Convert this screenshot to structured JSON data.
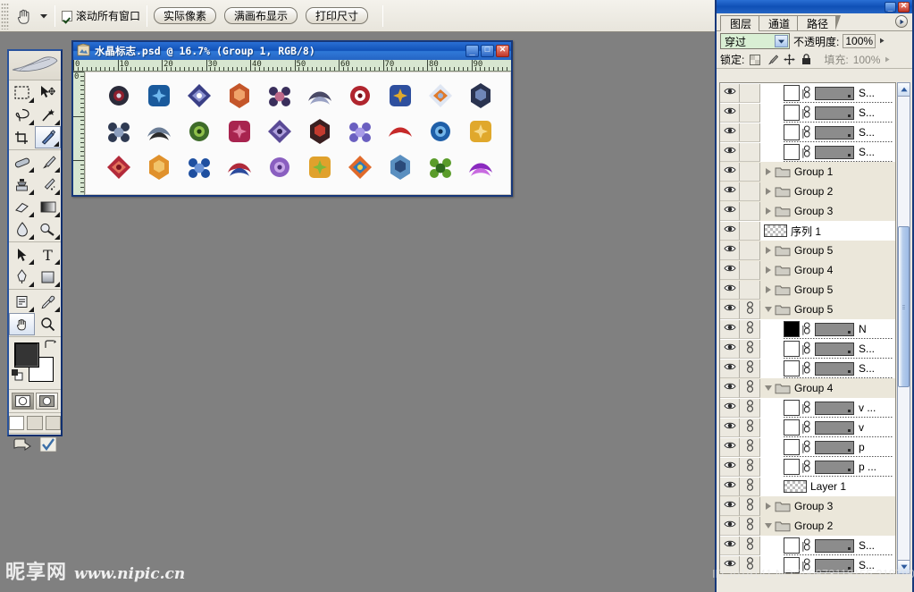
{
  "options_bar": {
    "tool_icon": "hand-tool-icon",
    "dropdown_icon": "chevron-down-icon",
    "checkbox": {
      "label": "滚动所有窗口",
      "checked": true
    },
    "buttons": [
      {
        "label": "实际像素"
      },
      {
        "label": "满画布显示"
      },
      {
        "label": "打印尺寸"
      }
    ]
  },
  "toolbox": {
    "logo_icon": "feather-logo-icon",
    "tools": [
      [
        {
          "icon": "marquee-tool-icon",
          "has_flyout": true
        },
        {
          "icon": "move-tool-icon",
          "has_flyout": false
        }
      ],
      [
        {
          "icon": "lasso-tool-icon",
          "has_flyout": true
        },
        {
          "icon": "magic-wand-tool-icon",
          "has_flyout": true
        }
      ],
      [
        {
          "icon": "crop-tool-icon",
          "has_flyout": false
        },
        {
          "icon": "slice-tool-icon",
          "has_flyout": true
        }
      ],
      [
        {
          "icon": "healing-brush-tool-icon",
          "has_flyout": true
        },
        {
          "icon": "brush-tool-icon",
          "has_flyout": true
        }
      ],
      [
        {
          "icon": "clone-stamp-tool-icon",
          "has_flyout": true
        },
        {
          "icon": "history-brush-tool-icon",
          "has_flyout": true
        }
      ],
      [
        {
          "icon": "eraser-tool-icon",
          "has_flyout": true
        },
        {
          "icon": "gradient-tool-icon",
          "has_flyout": true
        }
      ],
      [
        {
          "icon": "blur-tool-icon",
          "has_flyout": true
        },
        {
          "icon": "dodge-tool-icon",
          "has_flyout": true
        }
      ],
      [
        {
          "icon": "path-selection-tool-icon",
          "has_flyout": true
        },
        {
          "icon": "type-tool-icon",
          "has_flyout": true
        }
      ],
      [
        {
          "icon": "pen-tool-icon",
          "has_flyout": true
        },
        {
          "icon": "rectangle-shape-tool-icon",
          "has_flyout": true
        }
      ],
      [
        {
          "icon": "notes-tool-icon",
          "has_flyout": true
        },
        {
          "icon": "eyedropper-tool-icon",
          "has_flyout": true
        }
      ],
      [
        {
          "icon": "hand-tool-icon",
          "has_flyout": false,
          "selected": true
        },
        {
          "icon": "zoom-tool-icon",
          "has_flyout": false
        }
      ]
    ],
    "colors": {
      "foreground": "#343434",
      "background": "#ffffff"
    },
    "swap_icon": "swap-colors-icon",
    "default_colors_icon": "default-colors-icon",
    "quick_mask": [
      {
        "icon": "standard-mode-icon",
        "selected": true
      },
      {
        "icon": "quick-mask-mode-icon",
        "selected": false
      }
    ],
    "screen_modes": [
      {
        "icon": "standard-screen-icon",
        "selected": true
      },
      {
        "icon": "full-screen-menubar-icon"
      },
      {
        "icon": "full-screen-icon"
      }
    ],
    "jump_to": [
      {
        "icon": "jump-to-imageready-icon"
      },
      {
        "icon": "check-icon"
      }
    ]
  },
  "document": {
    "title": "水晶标志.psd @ 16.7% (Group 1, RGB/8)",
    "icon": "psd-document-icon",
    "window_buttons": [
      {
        "name": "minimize-button",
        "glyph": "_"
      },
      {
        "name": "maximize-button",
        "glyph": "□"
      },
      {
        "name": "close-button",
        "glyph": "✕"
      }
    ],
    "ruler": {
      "unit_ticks": [
        "0",
        "10",
        "20",
        "30",
        "40",
        "50",
        "60",
        "70",
        "80",
        "90"
      ],
      "vertical_ticks": [
        "0"
      ]
    },
    "zoom": "16.7%",
    "canvas_logos": [
      {
        "name": "logo-1",
        "colors": [
          "#2b2b3a",
          "#8f1f2e",
          "#d8d8e4"
        ],
        "shape": "eye-burst"
      },
      {
        "name": "logo-2",
        "colors": [
          "#1a5a9c",
          "#6fb8ee",
          "#0d2b4a"
        ],
        "shape": "rounded-square-star"
      },
      {
        "name": "logo-3",
        "colors": [
          "#3a3f86",
          "#8e95d2",
          "#ffffff"
        ],
        "shape": "tilted-dots-panel"
      },
      {
        "name": "logo-4",
        "colors": [
          "#c4562a",
          "#f0a36a",
          "#3a2018"
        ],
        "shape": "concentric-frame"
      },
      {
        "name": "logo-5",
        "colors": [
          "#3a2f5c",
          "#c06a8a",
          "#e8c86a"
        ],
        "shape": "floral-tile"
      },
      {
        "name": "logo-6",
        "colors": [
          "#4a4a66",
          "#9aa2c4",
          "#1d2235"
        ],
        "shape": "diamond-spike"
      },
      {
        "name": "logo-7",
        "colors": [
          "#b0252e",
          "#ffffff",
          "#6e1018"
        ],
        "shape": "striped-flag"
      },
      {
        "name": "logo-8",
        "colors": [
          "#2e4f9e",
          "#e0a92c",
          "#b32b33"
        ],
        "shape": "triangle-trio"
      },
      {
        "name": "logo-9",
        "colors": [
          "#dfe6f2",
          "#e07a2a",
          "#9fb4d8"
        ],
        "shape": "snow-capsule"
      },
      {
        "name": "logo-10",
        "colors": [
          "#2a3350",
          "#6f86b8",
          "#10182c"
        ],
        "shape": "hex-burst"
      },
      {
        "name": "logo-11",
        "colors": [
          "#2f3a52",
          "#8ea0bf",
          "#1a2338"
        ],
        "shape": "hex-globe"
      },
      {
        "name": "logo-12",
        "colors": [
          "#6b7d96",
          "#2b2b2b",
          "#c8ccd4"
        ],
        "shape": "arrow-bar"
      },
      {
        "name": "logo-13",
        "colors": [
          "#3e6b2a",
          "#8fc04a",
          "#1f3a14"
        ],
        "shape": "leaf-cluster"
      },
      {
        "name": "logo-14",
        "colors": [
          "#a8244f",
          "#e07ca0",
          "#5c0e2b"
        ],
        "shape": "rosette"
      },
      {
        "name": "logo-15",
        "colors": [
          "#5a4a96",
          "#b0a2dd",
          "#2e2356"
        ],
        "shape": "zigzag-diamond"
      },
      {
        "name": "logo-16",
        "colors": [
          "#3a1f20",
          "#c23a2e",
          "#0f0b0b"
        ],
        "shape": "x-cross-star"
      },
      {
        "name": "logo-17",
        "colors": [
          "#6a5fc0",
          "#a79ae8",
          "#3a3078"
        ],
        "shape": "spiked-sphere"
      },
      {
        "name": "logo-18",
        "colors": [
          "#c62a2a",
          "#ffffff",
          "#7a1414"
        ],
        "shape": "dice-pair"
      },
      {
        "name": "logo-19",
        "colors": [
          "#1f5fa8",
          "#74b6ea",
          "#0c2c52"
        ],
        "shape": "circle-arrows"
      },
      {
        "name": "logo-20",
        "colors": [
          "#e0a82c",
          "#f6d98a",
          "#9a6c10"
        ],
        "shape": "gold-x"
      },
      {
        "name": "logo-21",
        "colors": [
          "#b32a3a",
          "#e2725b",
          "#7a1420"
        ],
        "shape": "wave-hook"
      },
      {
        "name": "logo-22",
        "colors": [
          "#e0912c",
          "#f2c46a",
          "#b8651a"
        ],
        "shape": "molecule-dots"
      },
      {
        "name": "logo-23",
        "colors": [
          "#1e4fa0",
          "#6a93d8",
          "#0e2a58"
        ],
        "shape": "c-spiral"
      },
      {
        "name": "logo-24",
        "colors": [
          "#b02a3a",
          "#2b4a9c",
          "#ffffff"
        ],
        "shape": "double-wave"
      },
      {
        "name": "logo-25",
        "colors": [
          "#8a5fc0",
          "#c8a8e8",
          "#4a2e78"
        ],
        "shape": "squiggle"
      },
      {
        "name": "logo-26",
        "colors": [
          "#e0a12c",
          "#7fb83a",
          "#2e6a1e"
        ],
        "shape": "sun-leaf"
      },
      {
        "name": "logo-27",
        "colors": [
          "#e06a2a",
          "#2e7ab8",
          "#f2d24a"
        ],
        "shape": "lightning-circle"
      },
      {
        "name": "logo-28",
        "colors": [
          "#5a8fc0",
          "#2a4a7a",
          "#cfe0ee"
        ],
        "shape": "striped-diamond"
      },
      {
        "name": "logo-29",
        "colors": [
          "#5a9c2a",
          "#2e6a1e",
          "#a8d86a"
        ],
        "shape": "green-flower-tile"
      },
      {
        "name": "logo-30",
        "colors": [
          "#8a2abf",
          "#c86ae0",
          "#4a1070"
        ],
        "shape": "skull-shield"
      }
    ]
  },
  "layers_palette": {
    "window_buttons": [
      {
        "name": "palette-minimize-button",
        "glyph": "_"
      },
      {
        "name": "palette-close-button",
        "glyph": "✕"
      }
    ],
    "tabs": [
      {
        "label": "图层",
        "active": true
      },
      {
        "label": "通道",
        "active": false
      },
      {
        "label": "路径",
        "active": false
      }
    ],
    "menu_icon": "palette-menu-icon",
    "blend_mode": "穿过",
    "opacity_label": "不透明度:",
    "opacity_value": "100%",
    "lock_label": "锁定:",
    "lock_icons": [
      {
        "name": "lock-transparency-icon"
      },
      {
        "name": "lock-image-icon"
      },
      {
        "name": "lock-position-icon"
      },
      {
        "name": "lock-all-icon"
      }
    ],
    "fill_label": "填充:",
    "fill_value": "100%",
    "rows": [
      {
        "type": "child",
        "name": "S...",
        "thumb": "white",
        "mask": true,
        "visible": true,
        "linked": false
      },
      {
        "type": "child",
        "name": "S...",
        "thumb": "white",
        "mask": true,
        "visible": true,
        "linked": false
      },
      {
        "type": "child",
        "name": "S...",
        "thumb": "white",
        "mask": true,
        "visible": true,
        "linked": false
      },
      {
        "type": "child",
        "name": "S...",
        "thumb": "white",
        "mask": true,
        "visible": true,
        "linked": false
      },
      {
        "type": "group",
        "name": "Group 1",
        "expanded": false,
        "visible": true,
        "linked": false
      },
      {
        "type": "group",
        "name": "Group 2",
        "expanded": false,
        "visible": true,
        "linked": false
      },
      {
        "type": "group",
        "name": "Group 3",
        "expanded": false,
        "visible": true,
        "linked": false
      },
      {
        "type": "layer",
        "name": "序列 1",
        "thumb": "checker",
        "visible": true,
        "linked": false
      },
      {
        "type": "group",
        "name": "Group 5",
        "expanded": false,
        "visible": true,
        "linked": false
      },
      {
        "type": "group",
        "name": "Group 4",
        "expanded": false,
        "visible": true,
        "linked": false
      },
      {
        "type": "group",
        "name": "Group 5",
        "expanded": false,
        "visible": true,
        "linked": false
      },
      {
        "type": "group",
        "name": "Group 5",
        "expanded": true,
        "visible": true,
        "linked": true
      },
      {
        "type": "child",
        "name": "N",
        "thumb": "black",
        "mask": true,
        "visible": true,
        "linked": true
      },
      {
        "type": "child",
        "name": "S...",
        "thumb": "white",
        "mask": true,
        "visible": true,
        "linked": true
      },
      {
        "type": "child",
        "name": "S...",
        "thumb": "white",
        "mask": true,
        "visible": true,
        "linked": true
      },
      {
        "type": "group",
        "name": "Group 4",
        "expanded": true,
        "visible": true,
        "linked": true
      },
      {
        "type": "child",
        "name": "v ...",
        "thumb": "white",
        "mask": true,
        "visible": true,
        "linked": true
      },
      {
        "type": "child",
        "name": "v",
        "thumb": "white",
        "mask": true,
        "visible": true,
        "linked": true
      },
      {
        "type": "child",
        "name": "p",
        "thumb": "white",
        "mask": true,
        "visible": true,
        "linked": true
      },
      {
        "type": "child",
        "name": "p ...",
        "thumb": "white",
        "mask": true,
        "visible": true,
        "linked": true
      },
      {
        "type": "child",
        "name": "Layer 1",
        "thumb": "checker",
        "mask": false,
        "visible": true,
        "linked": true
      },
      {
        "type": "group",
        "name": "Group 3",
        "expanded": false,
        "visible": true,
        "linked": true
      },
      {
        "type": "group",
        "name": "Group 2",
        "expanded": true,
        "visible": true,
        "linked": true
      },
      {
        "type": "child",
        "name": "S...",
        "thumb": "white",
        "mask": true,
        "visible": true,
        "linked": true
      },
      {
        "type": "child",
        "name": "S...",
        "thumb": "white",
        "mask": true,
        "visible": true,
        "linked": true
      },
      {
        "type": "child",
        "name": "",
        "thumb": "white",
        "mask": true,
        "visible": true,
        "linked": true
      }
    ],
    "scrollbar": {
      "up_icon": "scroll-up-icon",
      "down_icon": "scroll-down-icon"
    }
  },
  "watermarks": {
    "site_name_cn": "昵享网",
    "site_url": "www.nipic.cn",
    "id_text": "ID:2019141 NO:200873118155.2197901"
  }
}
